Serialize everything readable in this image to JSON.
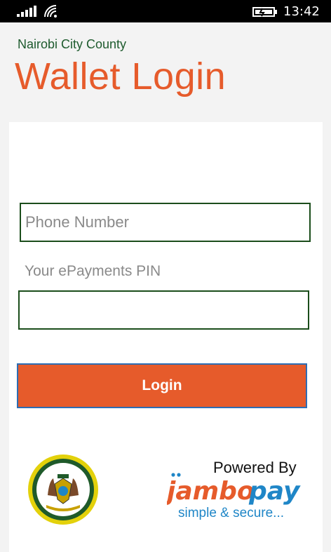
{
  "status_bar": {
    "time": "13:42",
    "signal_icon": "signal-strength-icon",
    "wifi_icon": "wifi-icon",
    "battery_icon": "battery-charging-icon"
  },
  "header": {
    "org": "Nairobi City County",
    "title": "Wallet Login"
  },
  "form": {
    "phone": {
      "placeholder": "Phone Number",
      "value": ""
    },
    "pin": {
      "label": "Your ePayments PIN",
      "value": ""
    },
    "login_label": "Login"
  },
  "footer": {
    "powered_by": "Powered By",
    "brand_jambo": "jambo",
    "brand_pay": "pay",
    "tagline": "simple & secure..."
  },
  "colors": {
    "accent": "#e65b2b",
    "green": "#1e5b2e",
    "blue": "#1f86c7"
  }
}
